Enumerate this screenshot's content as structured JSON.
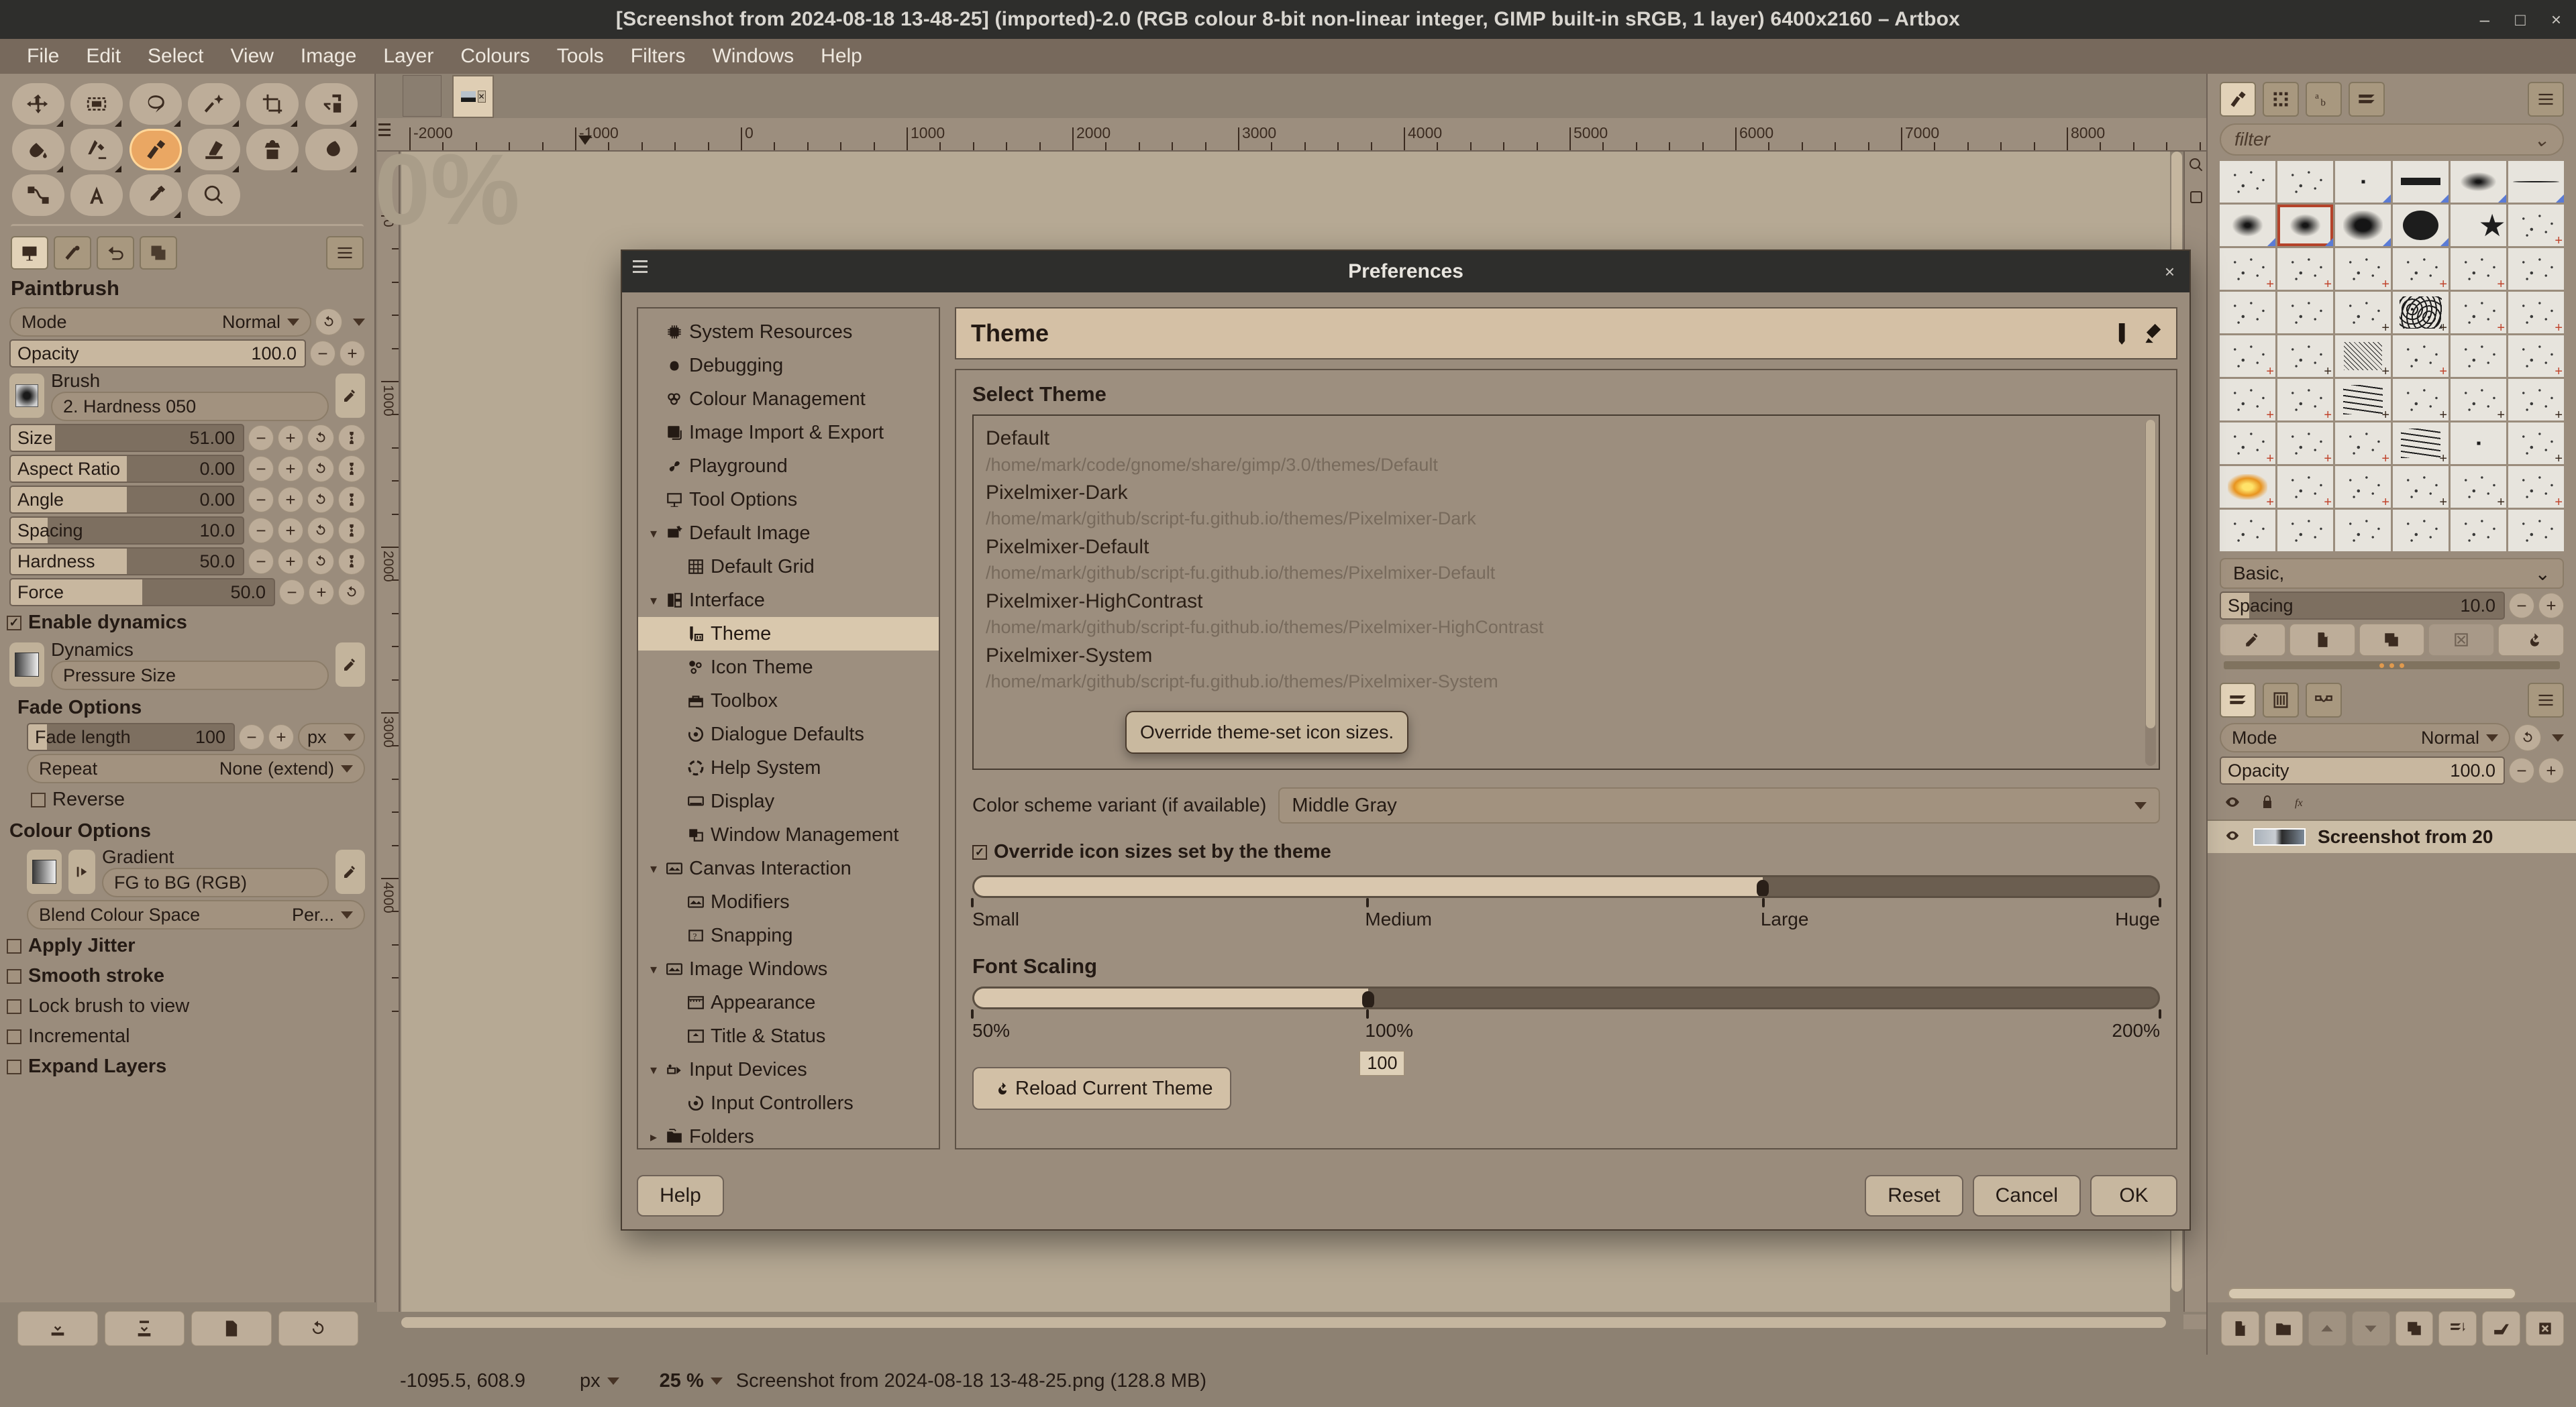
{
  "window": {
    "title": "[Screenshot from 2024-08-18 13-48-25] (imported)-2.0 (RGB colour 8-bit non-linear integer, GIMP built-in sRGB, 1 layer) 6400x2160 – Artbox",
    "minimize": "–",
    "maximize": "□",
    "close": "×"
  },
  "menubar": {
    "items": [
      "File",
      "Edit",
      "Select",
      "View",
      "Image",
      "Layer",
      "Colours",
      "Tools",
      "Filters",
      "Windows",
      "Help"
    ]
  },
  "toolbox": {
    "tools": [
      {
        "name": "move-tool",
        "selected": false,
        "corner": true
      },
      {
        "name": "rectangle-select-tool",
        "selected": false,
        "corner": true
      },
      {
        "name": "free-select-tool",
        "selected": false,
        "corner": true
      },
      {
        "name": "fuzzy-select-tool",
        "selected": false,
        "corner": true
      },
      {
        "name": "crop-tool",
        "selected": false,
        "corner": true
      },
      {
        "name": "transform-tool",
        "selected": false,
        "corner": true
      },
      {
        "name": "bucket-fill-tool",
        "selected": false,
        "corner": true
      },
      {
        "name": "gradient-tool",
        "selected": false,
        "corner": true
      },
      {
        "name": "paintbrush-tool",
        "selected": true,
        "corner": true
      },
      {
        "name": "eraser-tool",
        "selected": false,
        "corner": true
      },
      {
        "name": "clone-tool",
        "selected": false,
        "corner": true
      },
      {
        "name": "smudge-tool",
        "selected": false,
        "corner": true
      },
      {
        "name": "paths-tool",
        "selected": false,
        "corner": false
      },
      {
        "name": "text-tool",
        "selected": false,
        "corner": false
      },
      {
        "name": "color-picker-tool",
        "selected": false,
        "corner": true
      },
      {
        "name": "zoom-tool",
        "selected": false,
        "corner": false
      }
    ]
  },
  "tool_options": {
    "panel_title": "Paintbrush",
    "mode": {
      "label": "Mode",
      "value": "Normal"
    },
    "opacity": {
      "label": "Opacity",
      "value": "100.0",
      "fill_pct": 100
    },
    "brush": {
      "label": "Brush",
      "value": "2. Hardness 050"
    },
    "sliders": [
      {
        "label": "Size",
        "value": "51.00",
        "fill_pct": 19
      },
      {
        "label": "Aspect Ratio",
        "value": "0.00",
        "fill_pct": 50
      },
      {
        "label": "Angle",
        "value": "0.00",
        "fill_pct": 50
      },
      {
        "label": "Spacing",
        "value": "10.0",
        "fill_pct": 16
      },
      {
        "label": "Hardness",
        "value": "50.0",
        "fill_pct": 50
      },
      {
        "label": "Force",
        "value": "50.0",
        "fill_pct": 50
      }
    ],
    "enable_dynamics": {
      "label": "Enable dynamics",
      "checked": true
    },
    "dynamics": {
      "label": "Dynamics",
      "value": "Pressure Size"
    },
    "fade_options": {
      "title": "Fade Options",
      "fade_length": {
        "label": "Fade length",
        "value": "100",
        "unit": "px",
        "fill_pct": 9
      },
      "repeat": {
        "label": "Repeat",
        "value": "None (extend)"
      },
      "reverse": {
        "label": "Reverse",
        "checked": false
      }
    },
    "colour_options": {
      "title": "Colour Options",
      "gradient": {
        "label": "Gradient",
        "value": "FG to BG (RGB)"
      },
      "blend_colour_space": {
        "label": "Blend Colour Space",
        "value": "Per..."
      }
    },
    "checks": [
      {
        "label": "Apply Jitter",
        "checked": false,
        "bold": true
      },
      {
        "label": "Smooth stroke",
        "checked": false,
        "bold": true
      },
      {
        "label": "Lock brush to view",
        "checked": false,
        "bold": false
      },
      {
        "label": "Incremental",
        "checked": false,
        "bold": false
      },
      {
        "label": "Expand Layers",
        "checked": false,
        "bold": true
      }
    ],
    "bottom_buttons": [
      "save-tool-preset-icon",
      "restore-tool-preset-icon",
      "delete-tool-preset-icon",
      "reset-tool-options-icon"
    ]
  },
  "canvas": {
    "ruler_h_labels": [
      "-2000",
      "-1000",
      "0",
      "1000",
      "2000",
      "3000",
      "4000",
      "5000",
      "6000",
      "7000",
      "8000"
    ],
    "ruler_v_labels": [
      "0",
      "1000",
      "2000",
      "3000",
      "4000"
    ]
  },
  "statusbar": {
    "coordinates": "-1095.5, 608.9",
    "unit": "px",
    "zoom": "25 %",
    "filename": "Screenshot from 2024-08-18 13-48-25.png (128.8 MB)"
  },
  "right_dock": {
    "tabs": [
      "brushes-tab-icon",
      "patterns-tab-icon",
      "fonts-tab-icon",
      "layers-tab-icon"
    ],
    "menu_icon": "dock-menu-icon",
    "filter_placeholder": "filter",
    "brush_set": "Basic,",
    "spacing": {
      "label": "Spacing",
      "value": "10.0",
      "fill_pct": 10
    },
    "brush_buttons": [
      "edit-brush-icon",
      "new-brush-icon",
      "duplicate-brush-icon",
      "delete-brush-icon",
      "refresh-brushes-icon"
    ],
    "layers_tabs": [
      "layers-tab-icon",
      "channels-tab-icon",
      "paths-tab-icon"
    ],
    "mode": {
      "label": "Mode",
      "value": "Normal"
    },
    "opacity": {
      "label": "Opacity",
      "value": "100.0",
      "fill_pct": 100
    },
    "lock_icons": [
      "visibility-icon",
      "lock-pixels-icon",
      "lock-effects-icon"
    ],
    "layer_name": "Screenshot from 20",
    "bottom_buttons": [
      "new-layer-icon",
      "new-layer-group-icon",
      "raise-layer-icon",
      "lower-layer-icon",
      "duplicate-layer-icon",
      "merge-down-icon",
      "anchor-layer-icon",
      "delete-layer-icon"
    ]
  },
  "preferences": {
    "window_title": "Preferences",
    "close_label": "×",
    "nav": [
      {
        "label": "System Resources",
        "icon": "cpu-icon",
        "level": 1,
        "expander": "",
        "selected": false
      },
      {
        "label": "Debugging",
        "icon": "bug-icon",
        "level": 1,
        "expander": "",
        "selected": false
      },
      {
        "label": "Colour Management",
        "icon": "color-management-icon",
        "level": 1,
        "expander": "",
        "selected": false
      },
      {
        "label": "Image Import & Export",
        "icon": "import-export-icon",
        "level": 1,
        "expander": "",
        "selected": false
      },
      {
        "label": "Playground",
        "icon": "playground-icon",
        "level": 1,
        "expander": "",
        "selected": false
      },
      {
        "label": "Tool Options",
        "icon": "tool-options-icon",
        "level": 1,
        "expander": "",
        "selected": false
      },
      {
        "label": "Default Image",
        "icon": "default-image-icon",
        "level": 1,
        "expander": "▾",
        "selected": false
      },
      {
        "label": "Default Grid",
        "icon": "grid-icon",
        "level": 2,
        "expander": "",
        "selected": false
      },
      {
        "label": "Interface",
        "icon": "interface-icon",
        "level": 1,
        "expander": "▾",
        "selected": false
      },
      {
        "label": "Theme",
        "icon": "theme-icon",
        "level": 2,
        "expander": "",
        "selected": true
      },
      {
        "label": "Icon Theme",
        "icon": "icon-theme-icon",
        "level": 2,
        "expander": "",
        "selected": false
      },
      {
        "label": "Toolbox",
        "icon": "toolbox-icon",
        "level": 2,
        "expander": "",
        "selected": false
      },
      {
        "label": "Dialogue Defaults",
        "icon": "dialogue-defaults-icon",
        "level": 2,
        "expander": "",
        "selected": false
      },
      {
        "label": "Help System",
        "icon": "help-system-icon",
        "level": 2,
        "expander": "",
        "selected": false
      },
      {
        "label": "Display",
        "icon": "display-icon",
        "level": 2,
        "expander": "",
        "selected": false
      },
      {
        "label": "Window Management",
        "icon": "window-management-icon",
        "level": 2,
        "expander": "",
        "selected": false
      },
      {
        "label": "Canvas Interaction",
        "icon": "canvas-interaction-icon",
        "level": 1,
        "expander": "▾",
        "selected": false
      },
      {
        "label": "Modifiers",
        "icon": "modifiers-icon",
        "level": 2,
        "expander": "",
        "selected": false
      },
      {
        "label": "Snapping",
        "icon": "snapping-icon",
        "level": 2,
        "expander": "",
        "selected": false
      },
      {
        "label": "Image Windows",
        "icon": "image-windows-icon",
        "level": 1,
        "expander": "▾",
        "selected": false
      },
      {
        "label": "Appearance",
        "icon": "appearance-icon",
        "level": 2,
        "expander": "",
        "selected": false
      },
      {
        "label": "Title & Status",
        "icon": "title-status-icon",
        "level": 2,
        "expander": "",
        "selected": false
      },
      {
        "label": "Input Devices",
        "icon": "input-devices-icon",
        "level": 1,
        "expander": "▾",
        "selected": false
      },
      {
        "label": "Input Controllers",
        "icon": "input-controllers-icon",
        "level": 2,
        "expander": "",
        "selected": false
      },
      {
        "label": "Folders",
        "icon": "folders-icon",
        "level": 1,
        "expander": "▸",
        "selected": false
      }
    ],
    "page_title": "Theme",
    "page_icon": "theme-page-icon",
    "select_theme_label": "Select Theme",
    "themes": [
      {
        "name": "Default",
        "path": "/home/mark/code/gnome/share/gimp/3.0/themes/Default"
      },
      {
        "name": "Pixelmixer-Dark",
        "path": "/home/mark/github/script-fu.github.io/themes/Pixelmixer-Dark"
      },
      {
        "name": "Pixelmixer-Default",
        "path": "/home/mark/github/script-fu.github.io/themes/Pixelmixer-Default"
      },
      {
        "name": "Pixelmixer-HighContrast",
        "path": "/home/mark/github/script-fu.github.io/themes/Pixelmixer-HighContrast"
      },
      {
        "name": "Pixelmixer-System",
        "path": "/home/mark/github/script-fu.github.io/themes/Pixelmixer-System"
      }
    ],
    "color_scheme": {
      "label": "Color scheme variant (if available)",
      "value": "Middle Gray"
    },
    "override_icon_sizes": {
      "label": "Override icon sizes set by the theme",
      "checked": true
    },
    "icon_size_slider": {
      "labels": [
        "Small",
        "Medium",
        "Large",
        "Huge"
      ],
      "positions_pct": [
        0,
        33.3,
        66.6,
        100
      ],
      "value_pct": 66.6
    },
    "tooltip": "Override theme-set icon sizes.",
    "font_scaling": {
      "title": "Font Scaling",
      "labels": [
        "50%",
        "100%",
        "200%"
      ],
      "positions_pct": [
        0,
        33.3,
        100
      ],
      "value_pct": 33.3,
      "value": "100"
    },
    "reload_button": "Reload Current Theme",
    "footer": {
      "help": "Help",
      "reset": "Reset",
      "cancel": "Cancel",
      "ok": "OK"
    }
  }
}
